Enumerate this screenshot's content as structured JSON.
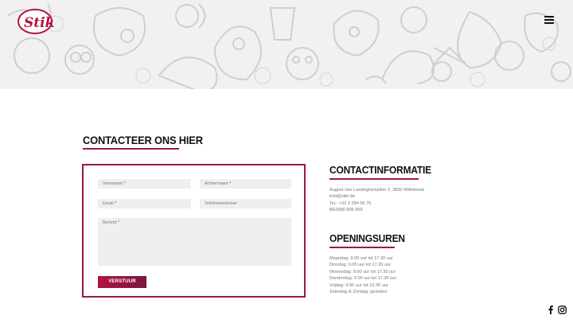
{
  "header": {
    "logo_text": "Stikr",
    "menu_icon": "hamburger-menu-icon"
  },
  "contact_form": {
    "heading": "CONTACTEER ONS HIER",
    "fields": {
      "first_name": {
        "label": "Voornaam",
        "required_mark": "*"
      },
      "last_name": {
        "label": "Achternaam",
        "required_mark": "*"
      },
      "email": {
        "label": "Email",
        "required_mark": "*"
      },
      "phone": {
        "label": "Telefoonnummer"
      },
      "message": {
        "label": "Bericht",
        "required_mark": "*"
      }
    },
    "submit_label": "VERSTUUR"
  },
  "contact_info": {
    "heading": "CONTACTINFORMATIE",
    "address": "August Van Landeghemplein 3, 2830 Willebroek",
    "email": "info@stikr.be",
    "phone": "Tel.: +32 3 284 56 76",
    "vat": "BE0680 896 869"
  },
  "opening_hours": {
    "heading": "OPENINGSUREN",
    "lines": [
      "Maandag: 9.00 uur tot 17.30 uur",
      "Dinsdag: 9.00 uur tot 17.30 uur",
      "Woensdag: 9.00 uur tot 17.30 uur",
      "Donderdag: 9.00 uur tot 17.30 uur",
      "Vrijdag: 9.00 uur tot 15.30 uur",
      "Zaterdag & Zondag: gesloten"
    ]
  },
  "social": {
    "facebook_icon": "facebook-icon",
    "instagram_icon": "instagram-icon"
  },
  "colors": {
    "brand": "#9c1a45",
    "button_start": "#b3143f",
    "button_end": "#7a1642"
  }
}
